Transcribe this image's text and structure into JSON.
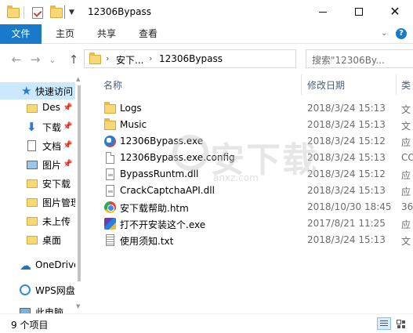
{
  "window": {
    "title": "12306Bypass",
    "controls": {
      "minimize": "minimize",
      "maximize": "maximize",
      "close": "✕"
    }
  },
  "ribbon": {
    "tabs": [
      {
        "label": "文件",
        "active": true
      },
      {
        "label": "主页",
        "active": false
      },
      {
        "label": "共享",
        "active": false
      },
      {
        "label": "查看",
        "active": false
      }
    ],
    "help": "?"
  },
  "navigation": {
    "back": "←",
    "forward": "→",
    "recent": "⌄",
    "up": "↑",
    "breadcrumb": [
      "安下...",
      "12306Bypass"
    ],
    "refresh": "↻",
    "search_placeholder": "搜索\"12306By..."
  },
  "sidebar": {
    "items": [
      {
        "label": "快速访问",
        "icon": "star-icon",
        "selected": true,
        "pinned": false
      },
      {
        "label": "Des",
        "icon": "folder-icon",
        "selected": false,
        "pinned": true
      },
      {
        "label": "下载",
        "icon": "download-icon",
        "selected": false,
        "pinned": true
      },
      {
        "label": "文档",
        "icon": "document-icon",
        "selected": false,
        "pinned": true
      },
      {
        "label": "图片",
        "icon": "picture-icon",
        "selected": false,
        "pinned": true
      },
      {
        "label": "安下载",
        "icon": "folder-icon",
        "selected": false,
        "pinned": false
      },
      {
        "label": "图片管理",
        "icon": "folder-icon",
        "selected": false,
        "pinned": false
      },
      {
        "label": "未上传",
        "icon": "folder-icon",
        "selected": false,
        "pinned": false
      },
      {
        "label": "桌面",
        "icon": "folder-icon",
        "selected": false,
        "pinned": false
      },
      {
        "label": "OneDrive",
        "icon": "cloud-icon",
        "selected": false,
        "pinned": false
      },
      {
        "label": "WPS网盘",
        "icon": "wps-icon",
        "selected": false,
        "pinned": false
      },
      {
        "label": "此电脑",
        "icon": "computer-icon",
        "selected": false,
        "pinned": false
      }
    ]
  },
  "columns": {
    "name": "名称",
    "date": "修改日期",
    "type": "类"
  },
  "files": [
    {
      "name": "Logs",
      "date": "2018/3/24 15:13",
      "type": "文",
      "icon": "folder-icon"
    },
    {
      "name": "Music",
      "date": "2018/3/24 15:13",
      "type": "文",
      "icon": "folder-icon"
    },
    {
      "name": "12306Bypass.exe",
      "date": "2018/3/24 15:12",
      "type": "应",
      "icon": "app-icon"
    },
    {
      "name": "12306Bypass.exe.config",
      "date": "2018/3/24 15:13",
      "type": "CO",
      "icon": "file-icon"
    },
    {
      "name": "BypassRuntm.dll",
      "date": "2018/3/24 15:12",
      "type": "应",
      "icon": "dll-icon"
    },
    {
      "name": "CrackCaptchaAPI.dll",
      "date": "2018/3/24 15:13",
      "type": "应",
      "icon": "dll-icon"
    },
    {
      "name": "安下载帮助.htm",
      "date": "2018/10/30 18:45",
      "type": "36",
      "icon": "browser-icon"
    },
    {
      "name": "打不开安装这个.exe",
      "date": "2017/8/21 11:25",
      "type": "应",
      "icon": "setup-icon"
    },
    {
      "name": "使用须知.txt",
      "date": "2018/3/24 15:13",
      "type": "文",
      "icon": "text-file-icon"
    }
  ],
  "watermark": {
    "text": "安下载",
    "sub": "anxz.com"
  },
  "status": {
    "count": "9 个项目"
  }
}
